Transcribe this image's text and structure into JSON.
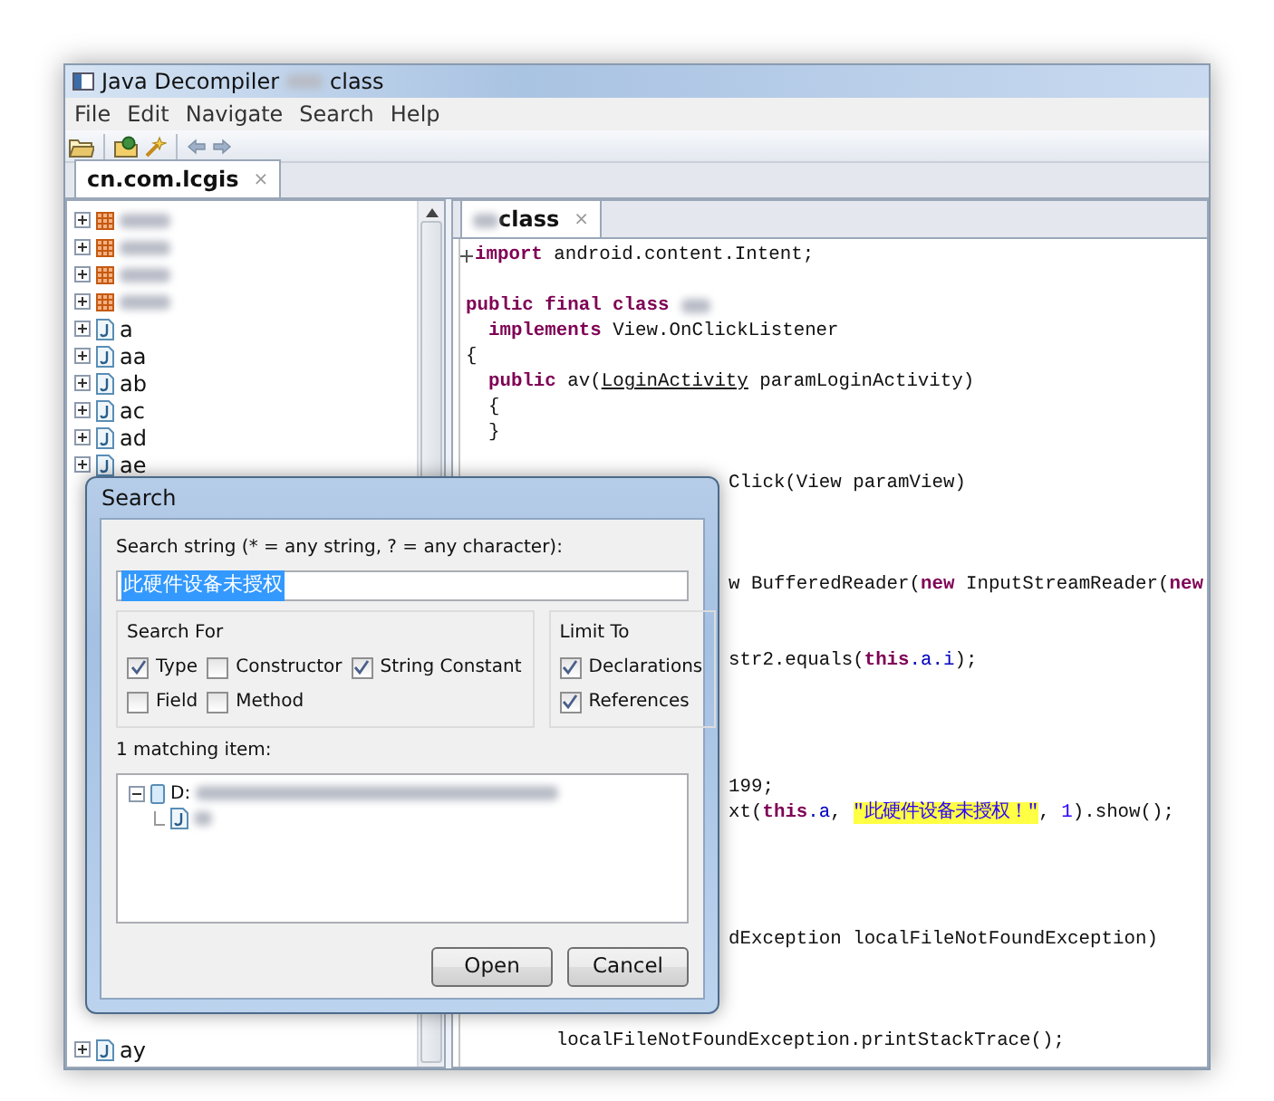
{
  "window": {
    "title": "Java Decompiler",
    "title_suffix": "class"
  },
  "menu": [
    "File",
    "Edit",
    "Navigate",
    "Search",
    "Help"
  ],
  "file_tab": {
    "label": "cn.com.lcgis",
    "close": "×",
    "selected": true
  },
  "tree": {
    "items": [
      {
        "kind": "package",
        "redacted": true
      },
      {
        "kind": "package",
        "redacted": true
      },
      {
        "kind": "package",
        "redacted": true
      },
      {
        "kind": "package",
        "redacted": true
      },
      {
        "kind": "class",
        "label": "a"
      },
      {
        "kind": "class",
        "label": "aa"
      },
      {
        "kind": "class",
        "label": "ab"
      },
      {
        "kind": "class",
        "label": "ac"
      },
      {
        "kind": "class",
        "label": "ad"
      },
      {
        "kind": "class",
        "label": "ae"
      }
    ],
    "bottom_items": [
      {
        "kind": "class",
        "label": "ay"
      }
    ]
  },
  "editor": {
    "tab": {
      "label": "class",
      "close": "×",
      "selected": true
    },
    "lines": [
      {
        "kind": "code",
        "folded": true,
        "segments": [
          {
            "kind": "keyword",
            "text": "import"
          },
          {
            "kind": "plain",
            "text": " android.content.Intent;"
          }
        ]
      },
      {
        "kind": "blank"
      },
      {
        "kind": "code",
        "segments": [
          {
            "kind": "keyword",
            "text": "public final class"
          },
          {
            "kind": "redacted"
          }
        ]
      },
      {
        "kind": "code",
        "segments": [
          {
            "kind": "keyword",
            "text": "  implements"
          },
          {
            "kind": "plain",
            "text": " View.OnClickListener"
          }
        ]
      },
      {
        "kind": "code",
        "segments": [
          {
            "kind": "plain",
            "text": "{"
          }
        ]
      },
      {
        "kind": "code",
        "segments": [
          {
            "kind": "keyword",
            "text": "  public"
          },
          {
            "kind": "plain",
            "text": " av("
          },
          {
            "kind": "link",
            "text": "LoginActivity"
          },
          {
            "kind": "plain",
            "text": " paramLoginActivity)"
          }
        ]
      },
      {
        "kind": "code",
        "segments": [
          {
            "kind": "plain",
            "text": "  {"
          }
        ]
      },
      {
        "kind": "code",
        "segments": [
          {
            "kind": "plain",
            "text": "  }"
          }
        ]
      },
      {
        "kind": "blank"
      },
      {
        "kind": "code",
        "covered": true,
        "segments": [
          {
            "kind": "plain",
            "text": "Click(View paramView)"
          }
        ]
      },
      {
        "kind": "blank"
      },
      {
        "kind": "blank"
      },
      {
        "kind": "blank"
      },
      {
        "kind": "code",
        "covered": true,
        "segments": [
          {
            "kind": "plain",
            "text": "w BufferedReader("
          },
          {
            "kind": "keyword",
            "text": "new"
          },
          {
            "kind": "plain",
            "text": " InputStreamReader("
          },
          {
            "kind": "keyword",
            "text": "new"
          }
        ]
      },
      {
        "kind": "blank"
      },
      {
        "kind": "blank"
      },
      {
        "kind": "code",
        "covered": true,
        "segments": [
          {
            "kind": "plain",
            "text": "str2.equals("
          },
          {
            "kind": "keyword",
            "text": "this"
          },
          {
            "kind": "field",
            "text": ".a.i"
          },
          {
            "kind": "plain",
            "text": ");"
          }
        ]
      },
      {
        "kind": "blank"
      },
      {
        "kind": "blank"
      },
      {
        "kind": "blank"
      },
      {
        "kind": "blank"
      },
      {
        "kind": "code",
        "covered": true,
        "segments": [
          {
            "kind": "plain",
            "text": "199;"
          }
        ]
      },
      {
        "kind": "code",
        "covered": true,
        "segments": [
          {
            "kind": "plain",
            "text": "xt("
          },
          {
            "kind": "keyword",
            "text": "this"
          },
          {
            "kind": "field",
            "text": ".a"
          },
          {
            "kind": "plain",
            "text": ", "
          },
          {
            "kind": "match",
            "text": "\"此硬件设备未授权！\""
          },
          {
            "kind": "plain",
            "text": ", "
          },
          {
            "kind": "number",
            "text": "1"
          },
          {
            "kind": "plain",
            "text": ").show();"
          }
        ]
      },
      {
        "kind": "blank"
      },
      {
        "kind": "blank"
      },
      {
        "kind": "blank"
      },
      {
        "kind": "blank"
      },
      {
        "kind": "code",
        "covered": true,
        "segments": [
          {
            "kind": "plain",
            "text": "dException localFileNotFoundException)"
          }
        ]
      },
      {
        "kind": "blank"
      },
      {
        "kind": "blank"
      },
      {
        "kind": "blank"
      },
      {
        "kind": "code",
        "segments": [
          {
            "kind": "plain",
            "text": "        localFileNotFoundException.printStackTrace();"
          }
        ]
      }
    ]
  },
  "dialog": {
    "title": "Search",
    "prompt": "Search string (* = any string, ? = any character):",
    "query": "此硬件设备未授权",
    "query_selected": true,
    "search_for": {
      "title": "Search For",
      "options": [
        {
          "label": "Type",
          "checked": true
        },
        {
          "label": "Constructor",
          "checked": false
        },
        {
          "label": "String Constant",
          "checked": true
        },
        {
          "label": "Field",
          "checked": false
        },
        {
          "label": "Method",
          "checked": false
        }
      ]
    },
    "limit_to": {
      "title": "Limit To",
      "options": [
        {
          "label": "Declarations",
          "checked": true
        },
        {
          "label": "References",
          "checked": true
        }
      ]
    },
    "results_label": "1 matching item:",
    "results": [
      {
        "label": "D:",
        "redacted": true,
        "expanded": true,
        "children": [
          {
            "redacted": true
          }
        ]
      }
    ],
    "buttons": [
      "Open",
      "Cancel"
    ]
  }
}
